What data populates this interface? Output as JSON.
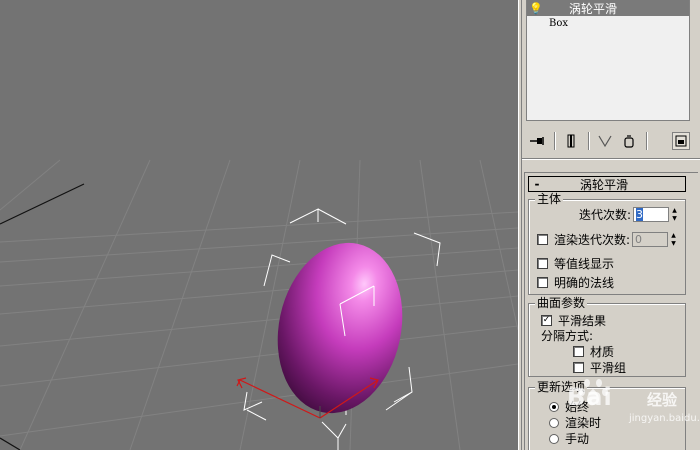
{
  "modifier_stack": {
    "selected_modifier": "涡轮平滑",
    "base_object": "Box"
  },
  "toolbar": {
    "icons": [
      "pin-stack-icon",
      "show-end-result-icon",
      "make-unique-icon",
      "remove-modifier-icon",
      "configure-modifier-sets-icon"
    ]
  },
  "rollout": {
    "collapse_symbol": "-",
    "title": "涡轮平滑",
    "main_group": {
      "title": "主体",
      "iterations_label": "迭代次数:",
      "iterations_value": "3",
      "render_iters_label": "渲染迭代次数:",
      "render_iters_value": "0",
      "render_iters_checked": false,
      "isoline_label": "等值线显示",
      "isoline_checked": false,
      "explicit_normals_label": "明确的法线",
      "explicit_normals_checked": false
    },
    "surface_group": {
      "title": "曲面参数",
      "smooth_result_label": "平滑结果",
      "smooth_result_checked": true,
      "separate_by_label": "分隔方式:",
      "materials_label": "材质",
      "materials_checked": false,
      "smoothing_groups_label": "平滑组",
      "smoothing_groups_checked": false
    },
    "update_group": {
      "title": "更新选项",
      "options": [
        "始终",
        "渲染时",
        "手动"
      ],
      "selected": "始终"
    }
  },
  "watermark": {
    "brand": "Bai",
    "brand_suffix": "经验",
    "url": "jingyan.baidu.com"
  },
  "colors": {
    "viewport_bg": "#737373",
    "panel_bg": "#d4d0c8",
    "object": "#d040c8",
    "gizmo": "#ffffff",
    "axis_red": "#d01818"
  }
}
